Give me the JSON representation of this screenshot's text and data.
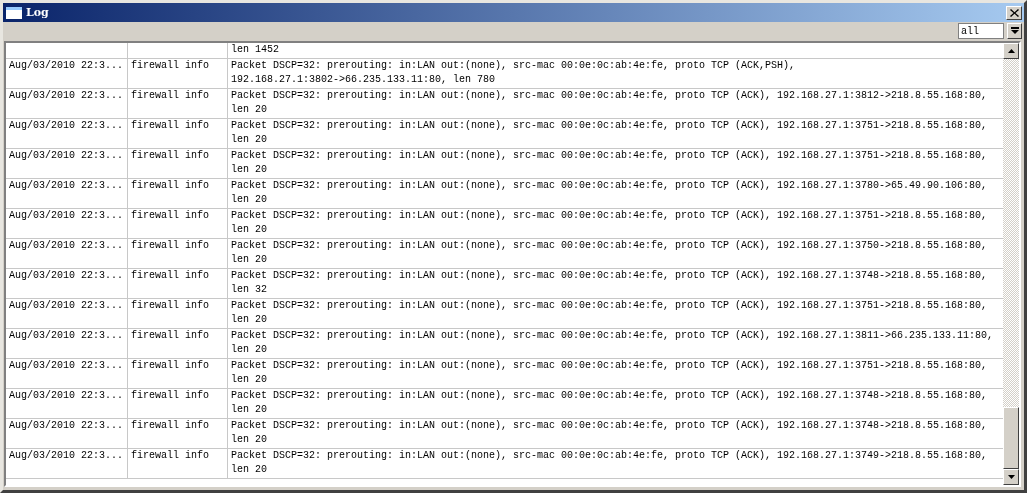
{
  "window": {
    "title": "Log"
  },
  "filter": {
    "value": "all"
  },
  "table": {
    "rows": [
      {
        "lines": [
          "len 1452"
        ]
      },
      {
        "time": "Aug/03/2010 22:3...",
        "topics": "firewall info",
        "lines": [
          "Packet DSCP=32: prerouting: in:LAN out:(none), src-mac 00:0e:0c:ab:4e:fe, proto TCP (ACK,PSH),",
          "192.168.27.1:3802->66.235.133.11:80, len 780"
        ]
      },
      {
        "time": "Aug/03/2010 22:3...",
        "topics": "firewall info",
        "lines": [
          "Packet DSCP=32: prerouting: in:LAN out:(none), src-mac 00:0e:0c:ab:4e:fe, proto TCP (ACK), 192.168.27.1:3812->218.8.55.168:80,",
          "len 20"
        ]
      },
      {
        "time": "Aug/03/2010 22:3...",
        "topics": "firewall info",
        "lines": [
          "Packet DSCP=32: prerouting: in:LAN out:(none), src-mac 00:0e:0c:ab:4e:fe, proto TCP (ACK), 192.168.27.1:3751->218.8.55.168:80,",
          "len 20"
        ]
      },
      {
        "time": "Aug/03/2010 22:3...",
        "topics": "firewall info",
        "lines": [
          "Packet DSCP=32: prerouting: in:LAN out:(none), src-mac 00:0e:0c:ab:4e:fe, proto TCP (ACK), 192.168.27.1:3751->218.8.55.168:80,",
          "len 20"
        ]
      },
      {
        "time": "Aug/03/2010 22:3...",
        "topics": "firewall info",
        "lines": [
          "Packet DSCP=32: prerouting: in:LAN out:(none), src-mac 00:0e:0c:ab:4e:fe, proto TCP (ACK), 192.168.27.1:3780->65.49.90.106:80,",
          "len 20"
        ]
      },
      {
        "time": "Aug/03/2010 22:3...",
        "topics": "firewall info",
        "lines": [
          "Packet DSCP=32: prerouting: in:LAN out:(none), src-mac 00:0e:0c:ab:4e:fe, proto TCP (ACK), 192.168.27.1:3751->218.8.55.168:80,",
          "len 20"
        ]
      },
      {
        "time": "Aug/03/2010 22:3...",
        "topics": "firewall info",
        "lines": [
          "Packet DSCP=32: prerouting: in:LAN out:(none), src-mac 00:0e:0c:ab:4e:fe, proto TCP (ACK), 192.168.27.1:3750->218.8.55.168:80,",
          "len 20"
        ]
      },
      {
        "time": "Aug/03/2010 22:3...",
        "topics": "firewall info",
        "lines": [
          "Packet DSCP=32: prerouting: in:LAN out:(none), src-mac 00:0e:0c:ab:4e:fe, proto TCP (ACK), 192.168.27.1:3748->218.8.55.168:80,",
          "len 32"
        ]
      },
      {
        "time": "Aug/03/2010 22:3...",
        "topics": "firewall info",
        "lines": [
          "Packet DSCP=32: prerouting: in:LAN out:(none), src-mac 00:0e:0c:ab:4e:fe, proto TCP (ACK), 192.168.27.1:3751->218.8.55.168:80,",
          "len 20"
        ]
      },
      {
        "time": "Aug/03/2010 22:3...",
        "topics": "firewall info",
        "lines": [
          "Packet DSCP=32: prerouting: in:LAN out:(none), src-mac 00:0e:0c:ab:4e:fe, proto TCP (ACK), 192.168.27.1:3811->66.235.133.11:80,",
          "len 20"
        ]
      },
      {
        "time": "Aug/03/2010 22:3...",
        "topics": "firewall info",
        "lines": [
          "Packet DSCP=32: prerouting: in:LAN out:(none), src-mac 00:0e:0c:ab:4e:fe, proto TCP (ACK), 192.168.27.1:3751->218.8.55.168:80,",
          "len 20"
        ]
      },
      {
        "time": "Aug/03/2010 22:3...",
        "topics": "firewall info",
        "lines": [
          "Packet DSCP=32: prerouting: in:LAN out:(none), src-mac 00:0e:0c:ab:4e:fe, proto TCP (ACK), 192.168.27.1:3748->218.8.55.168:80,",
          "len 20"
        ]
      },
      {
        "time": "Aug/03/2010 22:3...",
        "topics": "firewall info",
        "lines": [
          "Packet DSCP=32: prerouting: in:LAN out:(none), src-mac 00:0e:0c:ab:4e:fe, proto TCP (ACK), 192.168.27.1:3748->218.8.55.168:80,",
          "len 20"
        ]
      },
      {
        "time": "Aug/03/2010 22:3...",
        "topics": "firewall info",
        "lines": [
          "Packet DSCP=32: prerouting: in:LAN out:(none), src-mac 00:0e:0c:ab:4e:fe, proto TCP (ACK), 192.168.27.1:3749->218.8.55.168:80,",
          "len 20"
        ]
      }
    ]
  }
}
